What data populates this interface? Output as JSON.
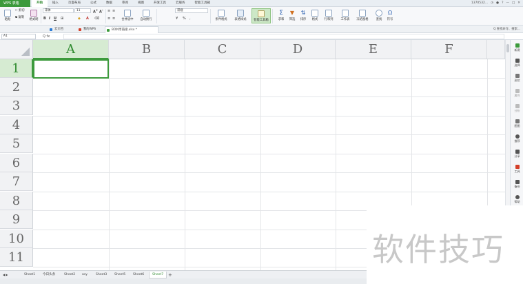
{
  "titlebar": {
    "app_name": "WPS 表格",
    "tabs": [
      "开始",
      "插入",
      "页面布局",
      "公式",
      "数据",
      "审阅",
      "视图",
      "开发工具",
      "云服务",
      "智能工具箱"
    ],
    "active_tab": 0,
    "user": "1370532...",
    "controls": [
      "◷",
      "●",
      "?",
      "—",
      "□",
      "✕"
    ]
  },
  "ribbon": {
    "paste": "粘贴",
    "cut": "剪切",
    "copy": "复制",
    "format_painter": "格式刷",
    "font_name": "宋体",
    "font_size": "11",
    "number_format": "常规",
    "merge_center": "合并居中",
    "wrap": "自动换行",
    "conditional_format": "条件格式",
    "table_style": "表格样式",
    "smart_toolbox": "智能工具箱",
    "sum": "求和",
    "filter": "筛选",
    "sort": "排序",
    "format": "格式",
    "rows_cols": "行和列",
    "worksheet": "工作表",
    "freeze": "冻结窗格",
    "find": "查找",
    "symbol": "符号"
  },
  "docbar": {
    "tabs": [
      {
        "label": "云文档",
        "color": "#2a7ad4"
      },
      {
        "label": "我的WPS",
        "color": "#d4402a"
      },
      {
        "label": "BD共享链接.xlsx *",
        "color": "#3c9a3c"
      }
    ],
    "active_tab": 2,
    "search_text": "Q 查找命令、搜索..."
  },
  "formula_bar": {
    "cell_ref": "A1",
    "icons": "Q  fx"
  },
  "grid": {
    "columns": [
      "A",
      "B",
      "C",
      "D",
      "E",
      "F"
    ],
    "rows": [
      "1",
      "2",
      "3",
      "4",
      "5",
      "6",
      "7",
      "8",
      "9",
      "10",
      "11"
    ],
    "selected_cell": "A1"
  },
  "side_panel": {
    "items": [
      {
        "label": "新建",
        "color": "#3c9a3c"
      },
      {
        "label": "选择",
        "color": "#555"
      },
      {
        "label": "形状",
        "color": "#777"
      },
      {
        "label": "属性",
        "color": "#999"
      },
      {
        "label": "分析",
        "color": "#999"
      },
      {
        "label": "图图",
        "color": "#777"
      },
      {
        "label": "推荐",
        "color": "#555"
      },
      {
        "label": "分享",
        "color": "#555"
      },
      {
        "label": "工具",
        "color": "#d4402a"
      },
      {
        "label": "备份",
        "color": "#555"
      },
      {
        "label": "帮助",
        "color": "#555"
      }
    ]
  },
  "sheets": {
    "tabs": [
      "Sheet1",
      "今日头条",
      "Sheet2",
      "asy",
      "Sheet3",
      "Sheet5",
      "Sheet6",
      "Sheet7"
    ],
    "active": 7,
    "add_label": "+"
  },
  "watermark": {
    "text": "软件技巧"
  }
}
